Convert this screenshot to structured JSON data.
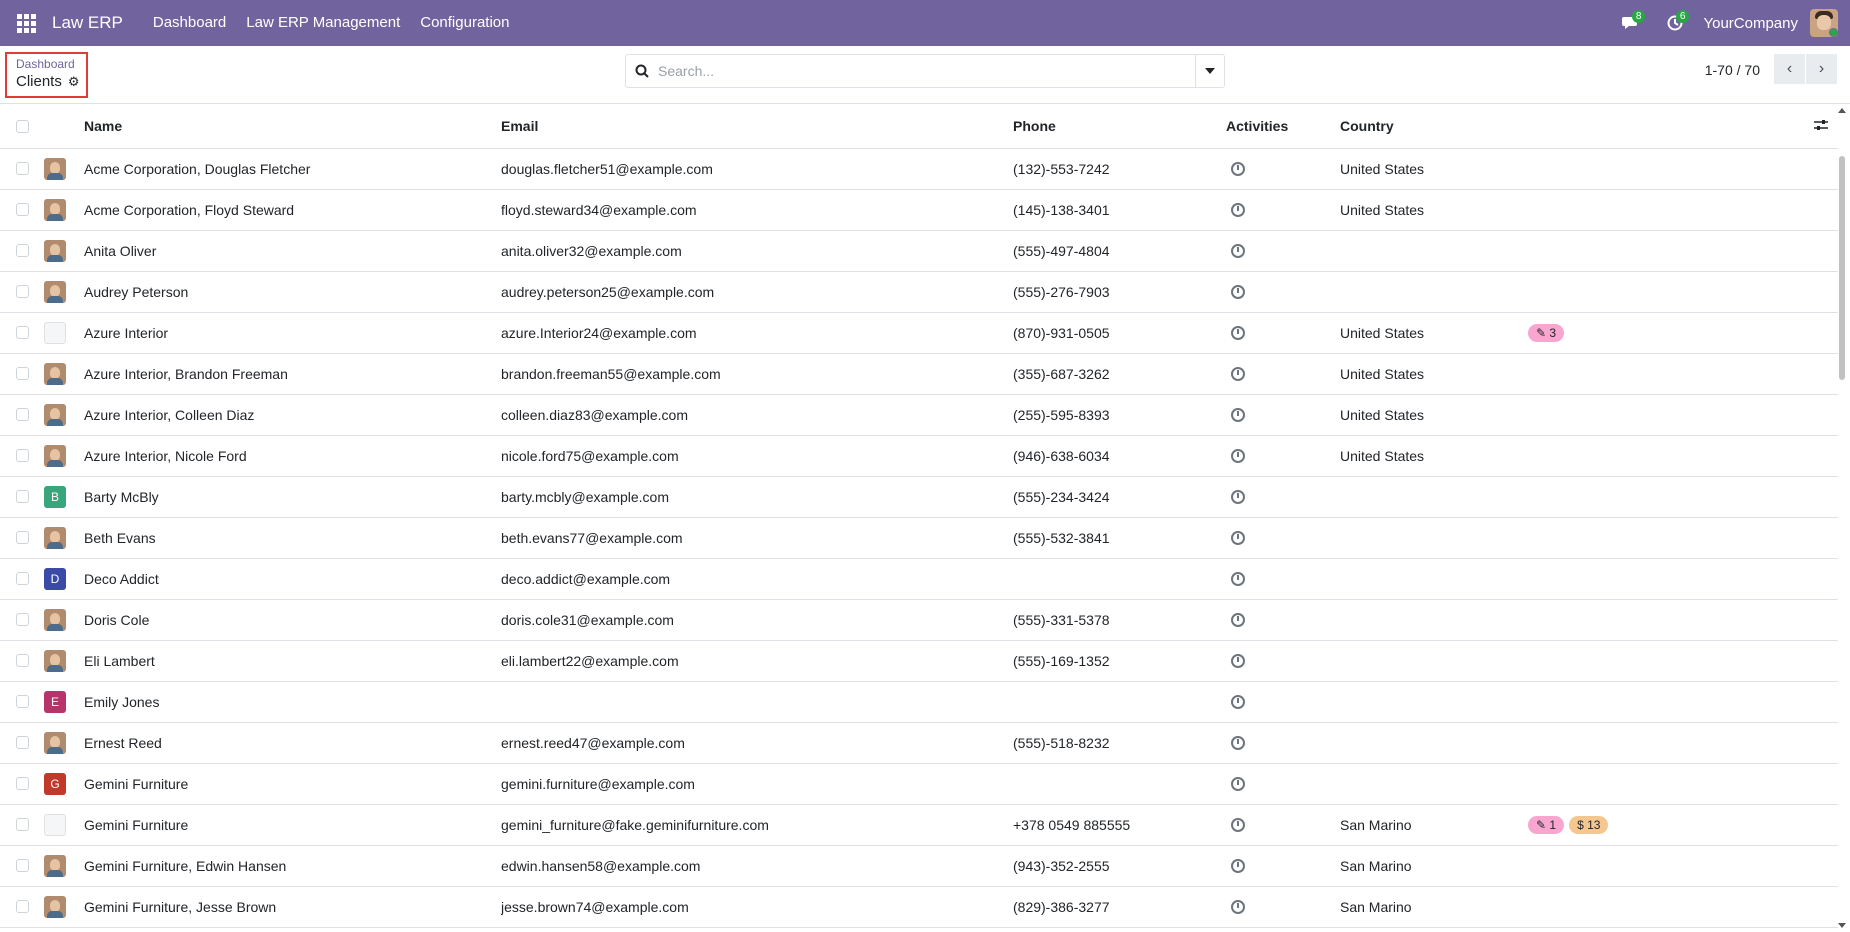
{
  "navbar": {
    "brand": "Law ERP",
    "menu": [
      "Dashboard",
      "Law ERP Management",
      "Configuration"
    ],
    "messages_count": "8",
    "activities_count": "6",
    "company": "YourCompany"
  },
  "breadcrumb": {
    "parent": "Dashboard",
    "current": "Clients"
  },
  "search": {
    "placeholder": "Search..."
  },
  "pager": {
    "range": "1-70 / 70"
  },
  "table": {
    "headers": {
      "name": "Name",
      "email": "Email",
      "phone": "Phone",
      "activities": "Activities",
      "country": "Country"
    },
    "rows": [
      {
        "name": "Acme Corporation, Douglas Fletcher",
        "email": "douglas.fletcher51@example.com",
        "phone": "(132)-553-7242",
        "country": "United States",
        "avatar": "photo"
      },
      {
        "name": "Acme Corporation, Floyd Steward",
        "email": "floyd.steward34@example.com",
        "phone": "(145)-138-3401",
        "country": "United States",
        "avatar": "photo"
      },
      {
        "name": "Anita Oliver",
        "email": "anita.oliver32@example.com",
        "phone": "(555)-497-4804",
        "country": "",
        "avatar": "photo"
      },
      {
        "name": "Audrey Peterson",
        "email": "audrey.peterson25@example.com",
        "phone": "(555)-276-7903",
        "country": "",
        "avatar": "photo"
      },
      {
        "name": "Azure Interior",
        "email": "azure.Interior24@example.com",
        "phone": "(870)-931-0505",
        "country": "United States",
        "avatar": "logo",
        "tags": [
          {
            "text": "3",
            "color": "pink",
            "icon": "edit-icon"
          }
        ]
      },
      {
        "name": "Azure Interior, Brandon Freeman",
        "email": "brandon.freeman55@example.com",
        "phone": "(355)-687-3262",
        "country": "United States",
        "avatar": "photo"
      },
      {
        "name": "Azure Interior, Colleen Diaz",
        "email": "colleen.diaz83@example.com",
        "phone": "(255)-595-8393",
        "country": "United States",
        "avatar": "photo"
      },
      {
        "name": "Azure Interior, Nicole Ford",
        "email": "nicole.ford75@example.com",
        "phone": "(946)-638-6034",
        "country": "United States",
        "avatar": "photo"
      },
      {
        "name": "Barty McBly",
        "email": "barty.mcbly@example.com",
        "phone": "(555)-234-3424",
        "country": "",
        "avatar": "letter",
        "letter": "B",
        "letter_color": "#3aa47c"
      },
      {
        "name": "Beth Evans",
        "email": "beth.evans77@example.com",
        "phone": "(555)-532-3841",
        "country": "",
        "avatar": "photo"
      },
      {
        "name": "Deco Addict",
        "email": "deco.addict@example.com",
        "phone": "",
        "country": "",
        "avatar": "letter",
        "letter": "D",
        "letter_color": "#3b4aa7"
      },
      {
        "name": "Doris Cole",
        "email": "doris.cole31@example.com",
        "phone": "(555)-331-5378",
        "country": "",
        "avatar": "photo"
      },
      {
        "name": "Eli Lambert",
        "email": "eli.lambert22@example.com",
        "phone": "(555)-169-1352",
        "country": "",
        "avatar": "photo"
      },
      {
        "name": "Emily Jones",
        "email": "",
        "phone": "",
        "country": "",
        "avatar": "letter",
        "letter": "E",
        "letter_color": "#b8336a"
      },
      {
        "name": "Ernest Reed",
        "email": "ernest.reed47@example.com",
        "phone": "(555)-518-8232",
        "country": "",
        "avatar": "photo"
      },
      {
        "name": "Gemini Furniture",
        "email": "gemini.furniture@example.com",
        "phone": "",
        "country": "",
        "avatar": "letter",
        "letter": "G",
        "letter_color": "#c0392b"
      },
      {
        "name": "Gemini Furniture",
        "email": "gemini_furniture@fake.geminifurniture.com",
        "phone": "+378 0549 885555",
        "country": "San Marino",
        "avatar": "logo",
        "tags": [
          {
            "text": "1",
            "color": "pink",
            "icon": "edit-icon"
          },
          {
            "text": "13",
            "color": "orange",
            "icon": "dollar-icon"
          }
        ]
      },
      {
        "name": "Gemini Furniture, Edwin Hansen",
        "email": "edwin.hansen58@example.com",
        "phone": "(943)-352-2555",
        "country": "San Marino",
        "avatar": "photo"
      },
      {
        "name": "Gemini Furniture, Jesse Brown",
        "email": "jesse.brown74@example.com",
        "phone": "(829)-386-3277",
        "country": "San Marino",
        "avatar": "photo"
      }
    ]
  }
}
